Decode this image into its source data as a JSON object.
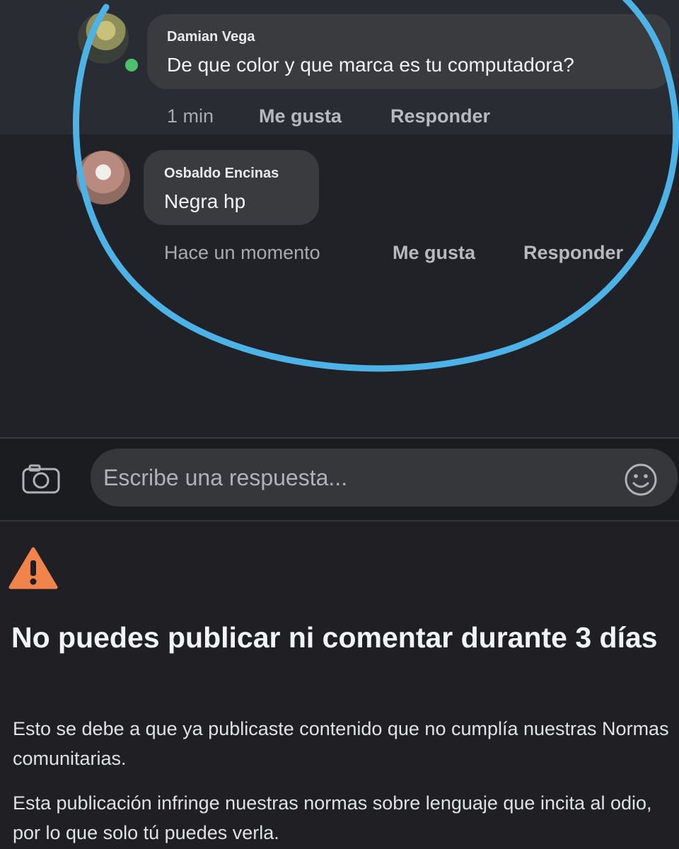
{
  "comments": [
    {
      "author": "Damian Vega",
      "text": "De que color y que marca es tu computadora?",
      "time": "1 min",
      "like_label": "Me gusta",
      "reply_label": "Responder",
      "online": true
    },
    {
      "author": "Osbaldo Encinas",
      "text": "Negra hp",
      "time": "Hace un momento",
      "like_label": "Me gusta",
      "reply_label": "Responder"
    }
  ],
  "composer": {
    "placeholder": "Escribe una respuesta..."
  },
  "restriction": {
    "title": "No puedes publicar ni comentar durante 3 días",
    "paragraph_1": "Esto se debe a que ya publicaste contenido que no cumplía nuestras Normas comunitarias.",
    "paragraph_2": "Esta publicación infringe nuestras normas sobre lenguaje que incita al odio, por lo que solo tú puedes verla."
  },
  "colors": {
    "annotation_circle": "#4db3e6",
    "warning": "#f0844a",
    "online": "#4cc16a"
  },
  "icons": [
    "camera-icon",
    "emoji-icon",
    "warning-icon"
  ]
}
